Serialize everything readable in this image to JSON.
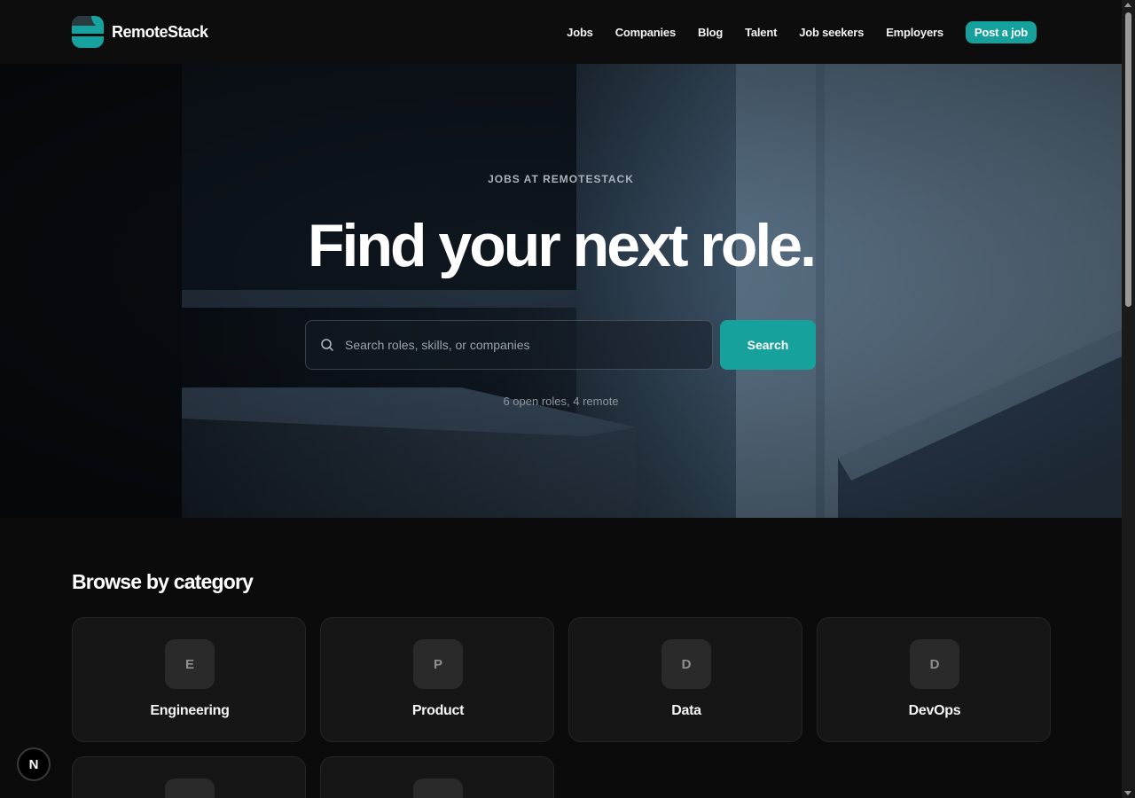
{
  "brand": {
    "name": "RemoteStack"
  },
  "nav": {
    "items": [
      "Jobs",
      "Companies",
      "Blog",
      "Talent",
      "Job seekers",
      "Employers"
    ],
    "cta": "Post a job"
  },
  "hero": {
    "eyebrow": "JOBS AT REMOTESTACK",
    "title": "Find your next role.",
    "search_placeholder": "Search roles, skills, or companies",
    "search_button": "Search",
    "stats": "6 open roles, 4 remote"
  },
  "categories": {
    "title": "Browse by category",
    "items": [
      {
        "initial": "E",
        "label": "Engineering"
      },
      {
        "initial": "P",
        "label": "Product"
      },
      {
        "initial": "D",
        "label": "Data"
      },
      {
        "initial": "D",
        "label": "DevOps"
      },
      {
        "initial": "",
        "label": ""
      },
      {
        "initial": "",
        "label": ""
      }
    ]
  },
  "dev_badge": {
    "letter": "N"
  },
  "colors": {
    "accent": "#17a19d",
    "background": "#0b0b0b",
    "card": "#161616"
  }
}
